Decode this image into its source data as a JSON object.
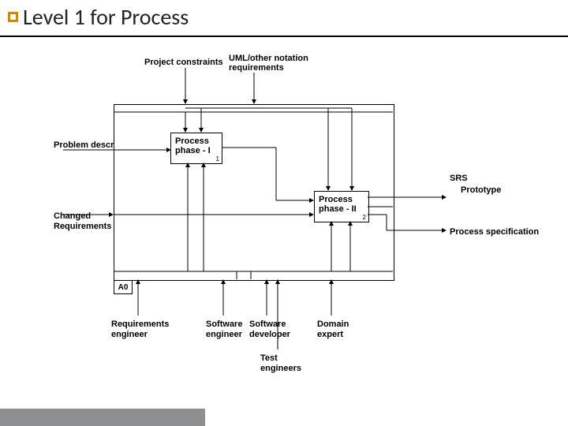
{
  "title": "Level 1 for Process",
  "top_inputs": {
    "project_constraints": "Project constraints",
    "uml": "UML/other notation",
    "requirements": "requirements"
  },
  "left_inputs": {
    "problem_description": "Problem description",
    "changed_requirements_l1": "Changed",
    "changed_requirements_l2": "Requirements"
  },
  "activities": {
    "a0": "A0",
    "p1_l1": "Process",
    "p1_l2": "phase - I",
    "p2_l1": "Process",
    "p2_l2": "phase - II"
  },
  "right_outputs": {
    "srs": "SRS",
    "prototype": "Prototype",
    "process_spec": "Process specification"
  },
  "mechanisms": {
    "req_eng_l1": "Requirements",
    "req_eng_l2": "engineer",
    "sw_eng_l1": "Software",
    "sw_eng_l2": "engineer",
    "sw_dev_l1": "Software",
    "sw_dev_l2": "developer",
    "domain_l1": "Domain",
    "domain_l2": "expert",
    "test_l1": "Test",
    "test_l2": "engineers"
  }
}
